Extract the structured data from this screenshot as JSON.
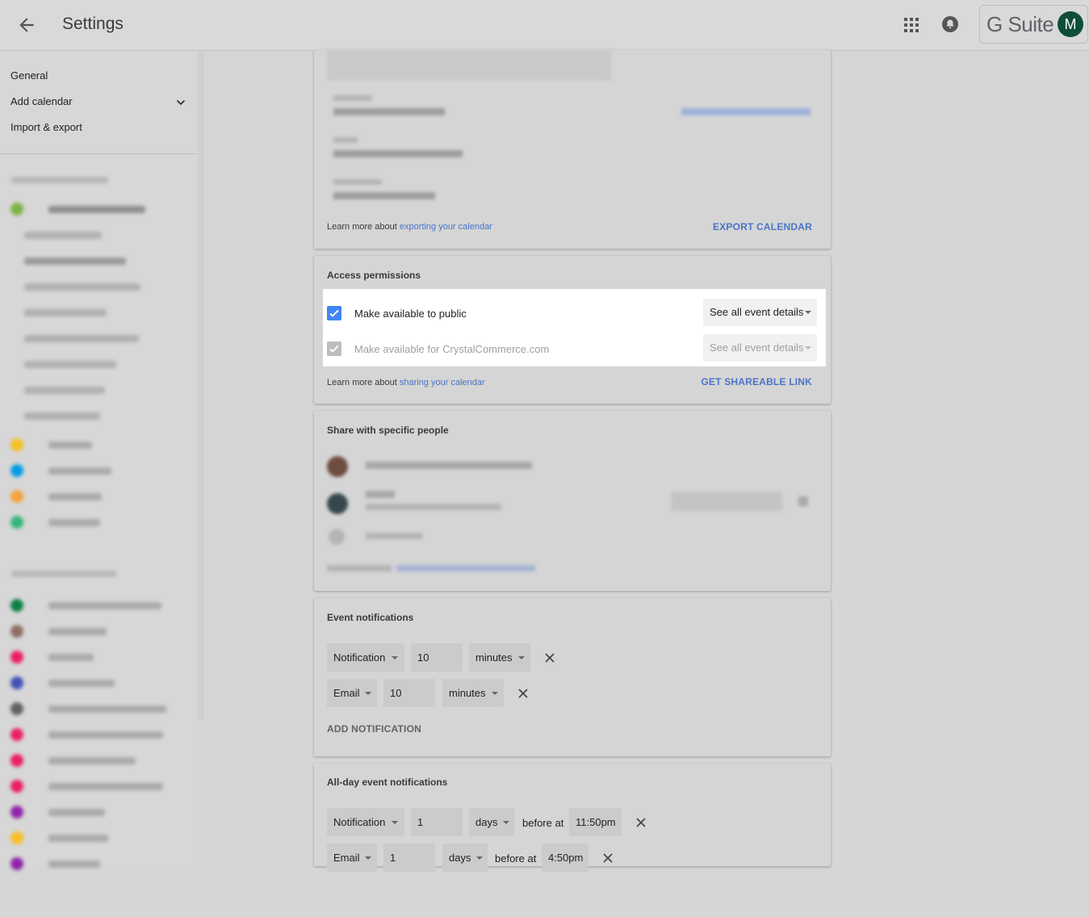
{
  "header": {
    "title": "Settings",
    "brand": "G Suite",
    "avatar_letter": "M"
  },
  "sidebar": {
    "items": [
      {
        "label": "General"
      },
      {
        "label": "Add calendar"
      },
      {
        "label": "Import & export"
      }
    ]
  },
  "export_card": {
    "learn_prefix": "Learn more about ",
    "learn_link": "exporting your calendar",
    "action": "EXPORT CALENDAR"
  },
  "access_card": {
    "title": "Access permissions",
    "public": {
      "label": "Make available to public",
      "checked": true,
      "select": "See all event details"
    },
    "domain": {
      "label": "Make available for CrystalCommerce.com",
      "checked": true,
      "disabled": true,
      "select": "See all event details"
    },
    "learn_prefix": "Learn more about ",
    "learn_link": "sharing your calendar",
    "action": "GET SHAREABLE LINK"
  },
  "share_card": {
    "title": "Share with specific people"
  },
  "event_notifications": {
    "title": "Event notifications",
    "rows": [
      {
        "type": "Notification",
        "value": "10",
        "unit": "minutes"
      },
      {
        "type": "Email",
        "value": "10",
        "unit": "minutes"
      }
    ],
    "add_label": "ADD NOTIFICATION"
  },
  "allday_notifications": {
    "title": "All-day event notifications",
    "rows": [
      {
        "type": "Notification",
        "value": "1",
        "unit": "days",
        "before": "before at",
        "time": "11:50pm"
      },
      {
        "type": "Email",
        "value": "1",
        "unit": "days",
        "before": "before at",
        "time": "4:50pm"
      }
    ]
  },
  "colors": {
    "accent": "#4a74c9",
    "checkbox": "#4285f4",
    "avatar": "#0f4e3b"
  }
}
